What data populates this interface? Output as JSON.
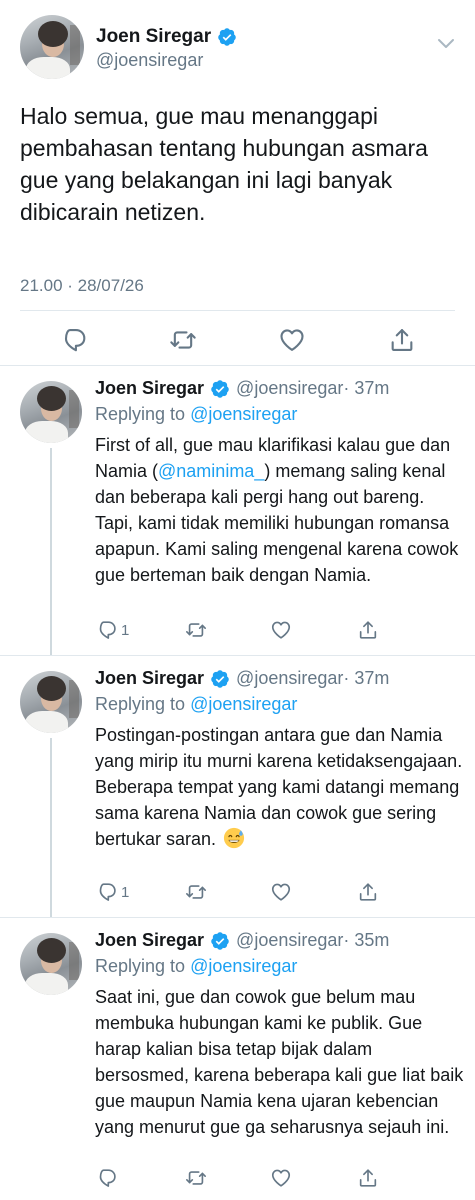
{
  "main_tweet": {
    "name": "Joen Siregar",
    "handle": "@joensiregar",
    "text": "Halo semua, gue mau menanggapi pembahasan tentang hubungan asmara gue yang belakangan ini lagi banyak dibicarain netizen.",
    "timestamp": "21.00 · 28/07/26"
  },
  "replies": [
    {
      "name": "Joen Siregar",
      "handle": "@joensiregar",
      "time": "· 37m",
      "replying_prefix": "Replying to ",
      "replying_to": "@joensiregar",
      "text_before": "First of all, gue mau klarifikasi kalau gue dan Namia (",
      "mention": "@naminima_",
      "text_after": ") memang saling kenal dan beberapa kali pergi hang out bareng. Tapi, kami tidak memiliki hubungan romansa apapun. Kami saling mengenal karena cowok gue berteman baik dengan Namia.",
      "reply_count": "1"
    },
    {
      "name": "Joen Siregar",
      "handle": "@joensiregar",
      "time": "· 37m",
      "replying_prefix": "Replying to ",
      "replying_to": "@joensiregar",
      "text": "Postingan-postingan antara gue dan Namia yang mirip itu murni karena ketidaksengajaan. Beberapa tempat yang kami datangi memang sama karena Namia dan cowok gue sering bertukar saran.",
      "emoji": "sweat-smile-emoji",
      "reply_count": "1"
    },
    {
      "name": "Joen Siregar",
      "handle": "@joensiregar",
      "time": "· 35m",
      "replying_prefix": "Replying to ",
      "replying_to": "@joensiregar",
      "text": "Saat ini, gue dan cowok gue belum mau membuka hubungan kami ke publik. Gue harap kalian bisa tetap bijak dalam bersosmed, karena beberapa kali gue liat baik gue maupun Namia kena ujaran kebencian yang menurut gue ga seharusnya sejauh ini.",
      "reply_count": ""
    }
  ],
  "colors": {
    "text": "#14171a",
    "secondary": "#657786",
    "link": "#1da1f2",
    "verified": "#1da1f2",
    "divider": "#e1e8ed"
  },
  "icons": [
    "verified-badge-icon",
    "chevron-down-icon",
    "reply-icon",
    "retweet-icon",
    "like-icon",
    "share-icon"
  ]
}
